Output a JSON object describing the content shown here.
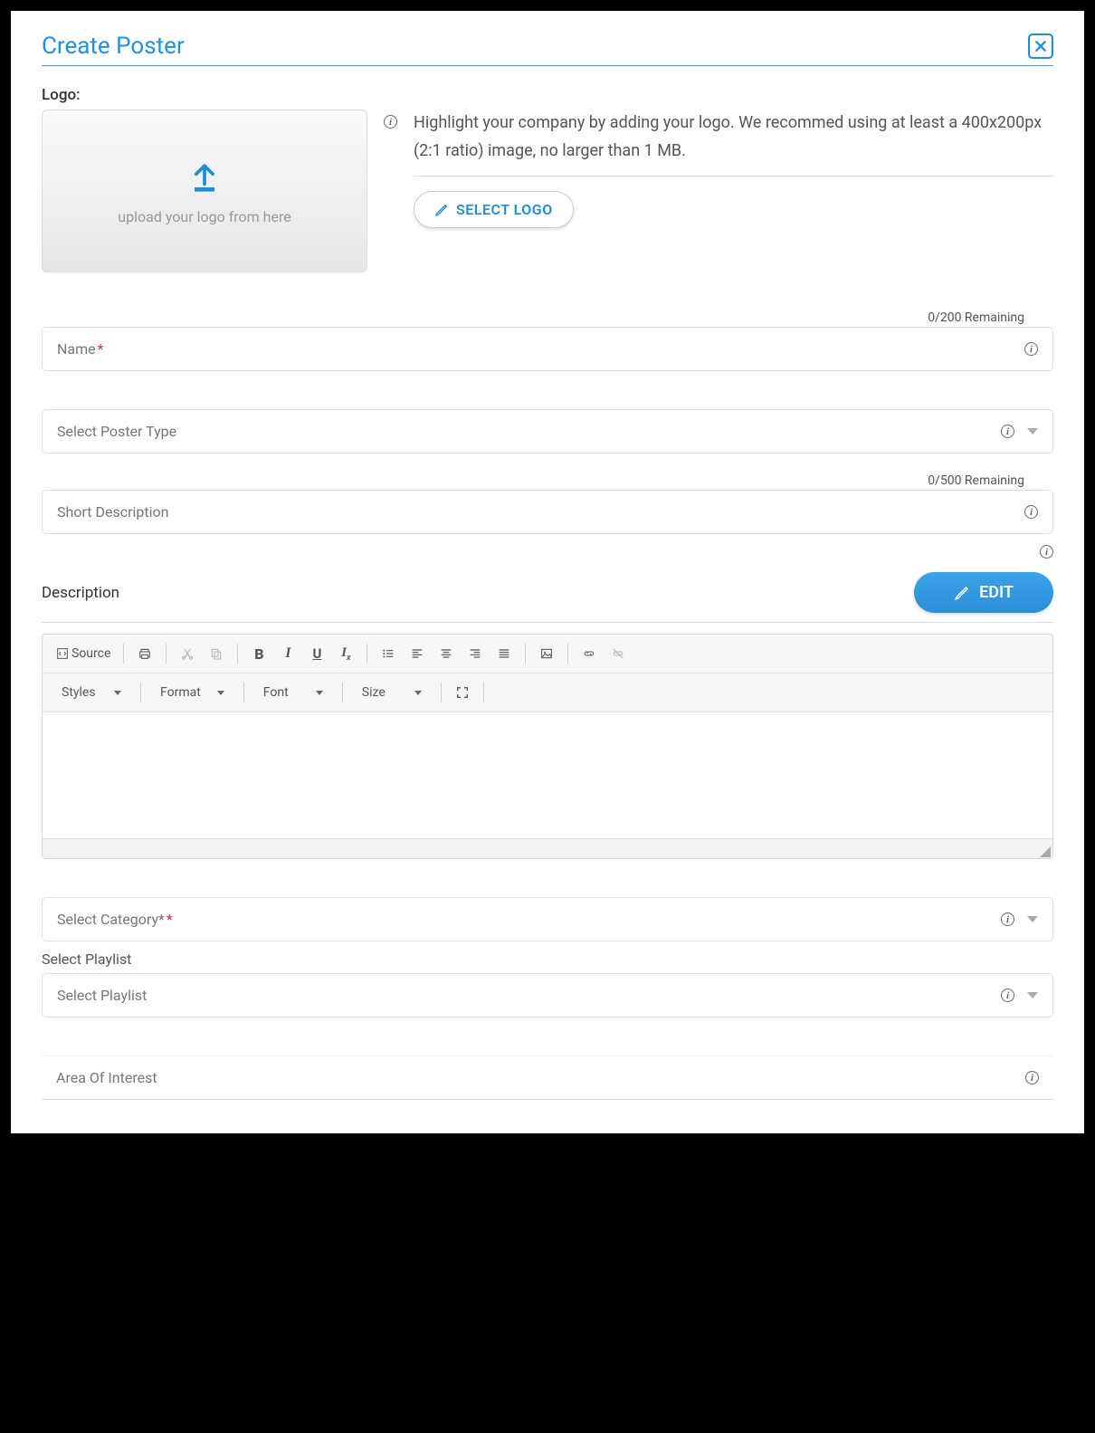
{
  "header": {
    "title": "Create Poster"
  },
  "logo": {
    "label": "Logo:",
    "upload_hint": "upload your logo from here",
    "help_text": "Highlight your company by adding your logo. We recommed using at least a 400x200px (2:1 ratio) image, no larger than 1 MB.",
    "select_button": "SELECT LOGO"
  },
  "name": {
    "counter": "0/200 Remaining",
    "placeholder": "Name",
    "required_marker": "*"
  },
  "poster_type": {
    "placeholder": "Select Poster Type"
  },
  "short_desc": {
    "counter": "0/500 Remaining",
    "placeholder": "Short Description"
  },
  "description": {
    "label": "Description",
    "edit_button": "EDIT"
  },
  "editor": {
    "source": "Source",
    "styles": "Styles",
    "format": "Format",
    "font": "Font",
    "size": "Size"
  },
  "category": {
    "placeholder": "Select Category*",
    "required_marker": "*"
  },
  "playlist": {
    "label": "Select Playlist",
    "placeholder": "Select Playlist"
  },
  "aoi": {
    "placeholder": "Area Of Interest"
  }
}
